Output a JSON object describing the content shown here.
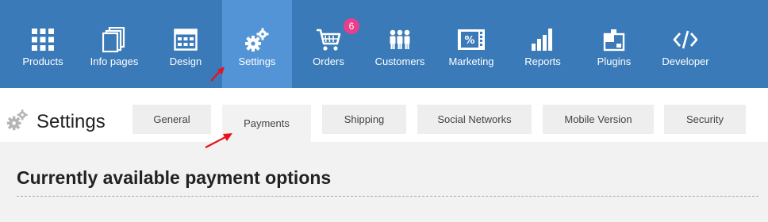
{
  "nav": {
    "items": [
      {
        "label": "Products",
        "icon": "grid-icon"
      },
      {
        "label": "Info pages",
        "icon": "pages-icon"
      },
      {
        "label": "Design",
        "icon": "design-icon"
      },
      {
        "label": "Settings",
        "icon": "gears-icon"
      },
      {
        "label": "Orders",
        "icon": "cart-icon"
      },
      {
        "label": "Customers",
        "icon": "people-icon"
      },
      {
        "label": "Marketing",
        "icon": "coupon-icon"
      },
      {
        "label": "Reports",
        "icon": "bar-chart-icon"
      },
      {
        "label": "Plugins",
        "icon": "puzzle-icon"
      },
      {
        "label": "Developer",
        "icon": "code-icon"
      }
    ],
    "orders_badge": "6",
    "active": "Settings"
  },
  "page": {
    "title": "Settings",
    "tabs": [
      "General",
      "Payments",
      "Shipping",
      "Social Networks",
      "Mobile Version",
      "Security"
    ],
    "active_tab": "Payments"
  },
  "content": {
    "section_title": "Currently available payment options"
  },
  "colors": {
    "nav_bg": "#3a7ab8",
    "nav_active": "#5294d6",
    "badge": "#e83e8c",
    "annotation_arrow": "#e8121b"
  }
}
